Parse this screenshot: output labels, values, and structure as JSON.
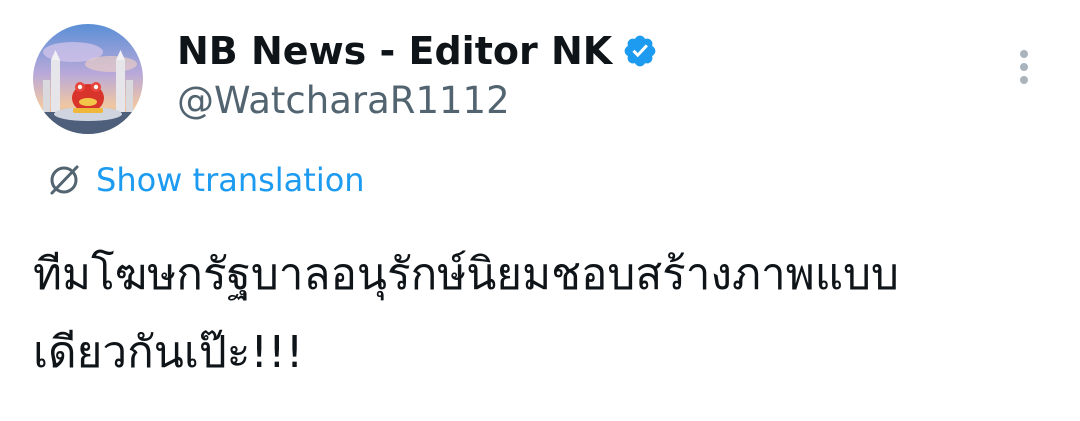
{
  "author": {
    "display_name": "NB News - Editor NK",
    "handle": "@WatcharaR1112",
    "verified": true,
    "verified_color": "#1d9bf0"
  },
  "actions": {
    "more_icon": "more-vertical-icon",
    "translate_icon": "translate-icon",
    "translate_label": "Show translation"
  },
  "tweet": {
    "text": "ทีมโฆษกรัฐบาลอนุรักษ์นิยมชอบสร้างภาพแบบ\nเดียวกันเป๊ะ!!!"
  },
  "colors": {
    "text_primary": "#0f1419",
    "text_secondary": "#536471",
    "accent": "#1d9bf0"
  }
}
